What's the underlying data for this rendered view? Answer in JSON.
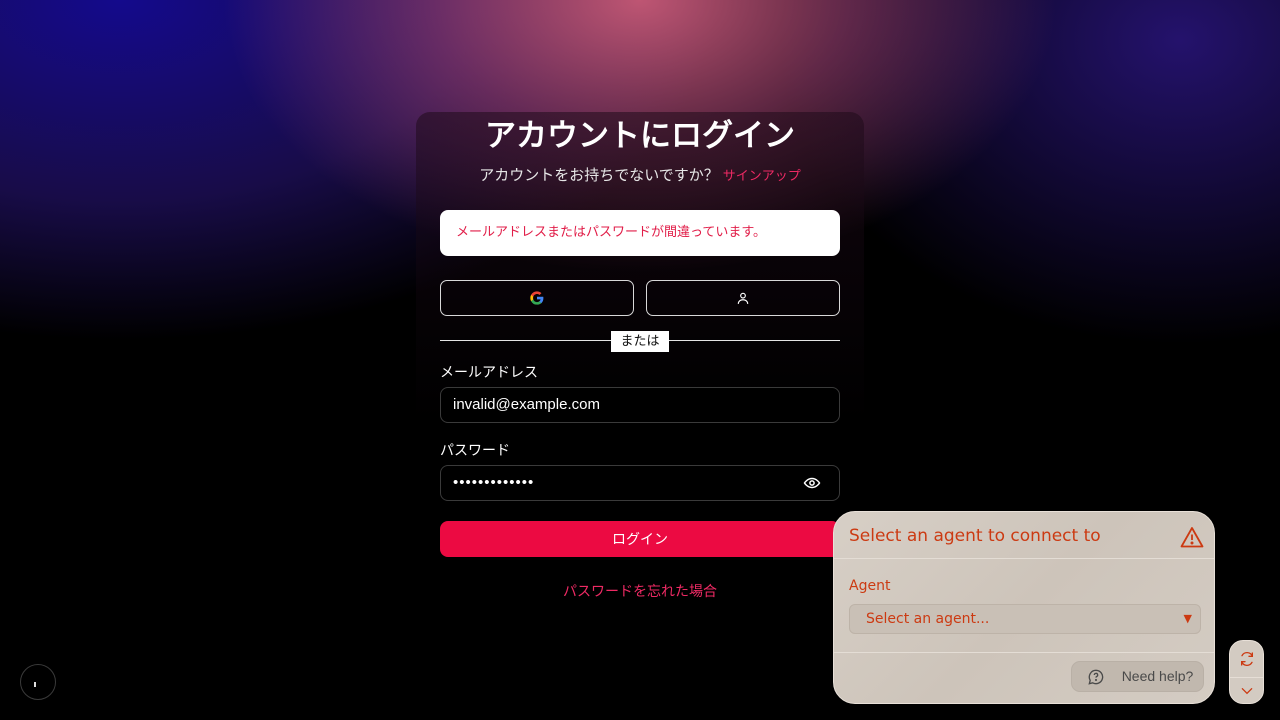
{
  "login": {
    "title": "アカウントにログイン",
    "no_account_text": "アカウントをお持ちでないですか？",
    "signup_link": "サインアップ",
    "error_message": "メールアドレスまたはパスワードが間違っています。",
    "divider_text": "または",
    "email_label": "メールアドレス",
    "email_value": "invalid@example.com",
    "password_label": "パスワード",
    "password_masked": "•••••••••••••",
    "login_button": "ログイン",
    "forgot_link": "パスワードを忘れた場合"
  },
  "agent_panel": {
    "title": "Select an agent to connect to",
    "agent_label": "Agent",
    "select_placeholder": "Select an agent...",
    "help_button": "Need help?"
  },
  "colors": {
    "accent": "#ec0a42",
    "link": "#ee2a64",
    "error_text": "#e11d48",
    "panel_text": "#cc3a12"
  },
  "icons": {
    "oauth_left": "google-icon",
    "oauth_right": "user-icon",
    "password_toggle": "eye-icon",
    "panel_status": "warning-icon",
    "help": "chat-help-icon",
    "refresh": "refresh-icon",
    "collapse": "chevron-down-icon"
  }
}
